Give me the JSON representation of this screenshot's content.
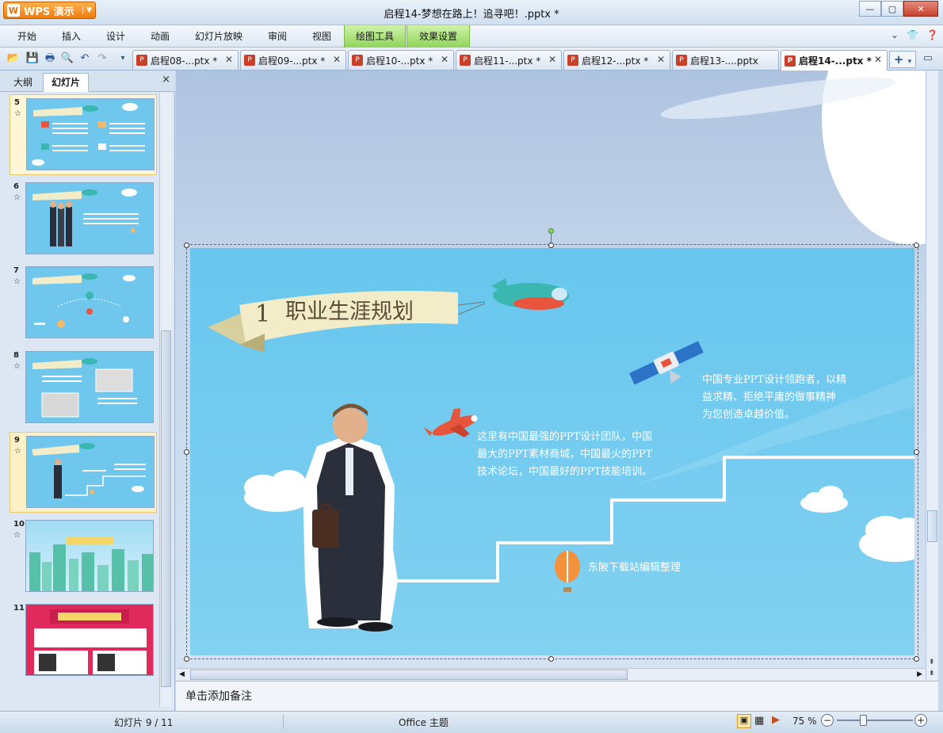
{
  "titlebar": {
    "app_name": "WPS 演示",
    "app_logo": "W",
    "document_title": "启程14-梦想在路上！追寻吧！.pptx *",
    "minimize": "—",
    "maximize": "▢",
    "close": "✕"
  },
  "ribbon": {
    "tabs": [
      "开始",
      "插入",
      "设计",
      "动画",
      "幻灯片放映",
      "审阅",
      "视图"
    ],
    "context_tabs": [
      "绘图工具",
      "效果设置"
    ],
    "right_icons": [
      "chevron-down-icon",
      "shirt-icon",
      "help-icon"
    ]
  },
  "doc_tabs": [
    {
      "label": "启程08-...ptx *",
      "active": false
    },
    {
      "label": "启程09-...ptx *",
      "active": false
    },
    {
      "label": "启程10-...ptx *",
      "active": false
    },
    {
      "label": "启程11-...ptx *",
      "active": false
    },
    {
      "label": "启程12-...ptx *",
      "active": false
    },
    {
      "label": "启程13-....pptx",
      "active": false
    },
    {
      "label": "启程14-...ptx *",
      "active": true
    }
  ],
  "left_panel": {
    "tabs": [
      "大纲",
      "幻灯片"
    ],
    "active_tab": "幻灯片",
    "close": "×",
    "thumbnails": [
      {
        "number": "5",
        "has_star": true
      },
      {
        "number": "6",
        "has_star": true
      },
      {
        "number": "7",
        "has_star": true
      },
      {
        "number": "8",
        "has_star": true
      },
      {
        "number": "9",
        "has_star": true,
        "selected": true
      },
      {
        "number": "10",
        "has_star": true
      },
      {
        "number": "11",
        "has_star": false
      }
    ],
    "star_glyph": "☆"
  },
  "slide": {
    "section_number": "1",
    "section_title": "职业生涯规划",
    "text_top_right": "中国专业PPT设计领跑者，以精益求精、拒绝平庸的做事精神为您创造卓越价值。",
    "text_top_right_lines": [
      "中国专业PPT设计领跑者，以精",
      "益求精、拒绝平庸的做事精神",
      "为您创造卓越价值。"
    ],
    "text_middle_lines": [
      "这里有中国最强的PPT设计团队，中国",
      "最大的PPT素材商城，中国最火的PPT",
      "技术论坛，中国最好的PPT技能培训。"
    ],
    "text_bottom": "东陂下载站编辑整理",
    "colors": {
      "sky": "#6cc8ef",
      "banner": "#f3ecc8",
      "plane_teal": "#3ab7b0",
      "plane_red": "#e8553c"
    }
  },
  "notes": {
    "placeholder": "单击添加备注"
  },
  "statusbar": {
    "slide_counter": "幻灯片 9 / 11",
    "theme": "Office 主题",
    "zoom": "75 %"
  }
}
